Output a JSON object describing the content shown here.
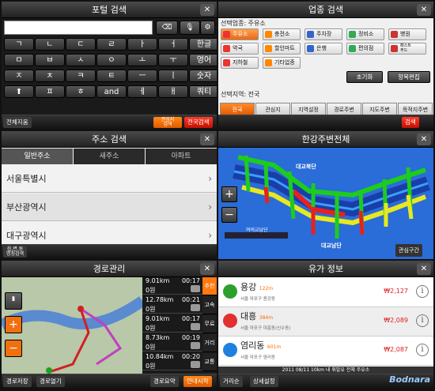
{
  "panel1": {
    "title": "포털 검색",
    "close": "✕",
    "del": "⌫",
    "mic": "🎙",
    "gear": "⚙",
    "keys": [
      [
        "ㄱ",
        "ㄴ",
        "ㄷ",
        "ㄹ",
        "ㅏ",
        "ㅓ"
      ],
      [
        "ㅁ",
        "ㅂ",
        "ㅅ",
        "ㅇ",
        "ㅗ",
        "ㅜ"
      ],
      [
        "ㅈ",
        "ㅊ",
        "ㅋ",
        "ㅌ",
        "ㅡ",
        "ㅣ"
      ],
      [
        "⬆",
        "ㅍ",
        "ㅎ",
        "and",
        "ㅔ",
        "ㅐ"
      ]
    ],
    "func_keys": [
      "한글",
      "영어",
      "숫자",
      "쿼티"
    ],
    "clear": "전체지움",
    "nearby": "관심지\n검색",
    "full": "전국검색"
  },
  "panel2": {
    "title": "업종 검색",
    "close": "✕",
    "selected_label": "선택업종: 주유소",
    "cats": [
      [
        "주유소",
        "충전소",
        "주차장",
        "정비소",
        "병원"
      ],
      [
        "약국",
        "할인마트",
        "은행",
        "편의점",
        "패스트\n푸드"
      ],
      [
        "지하철",
        "기타업종"
      ]
    ],
    "init": "초기화",
    "edit": "항목편집",
    "region_label": "선택지역: 전국",
    "tabs": [
      "전국",
      "관심지",
      "지역설정",
      "경로주변",
      "지도주변",
      "목적지주변"
    ],
    "search": "검색"
  },
  "panel3": {
    "title": "주소 검색",
    "close": "✕",
    "tabs": [
      "일반주소",
      "새주소",
      "아파트"
    ],
    "items": [
      "서울특별시",
      "부산광역시",
      "대구광역시"
    ],
    "bottom": "읍,면,동\n명칭검색"
  },
  "panel4": {
    "title": "한강주변전체",
    "close": "✕",
    "map_labels": [
      "성산",
      "양화",
      "서강",
      "원효",
      "한남",
      "동호",
      "성수",
      "영동",
      "청담",
      "잠실",
      "마포",
      "대교북단",
      "동작",
      "반포",
      "한남",
      "가양",
      "성수",
      "여의교",
      "여의교남단",
      "서울교남단",
      "대교남단",
      "구리"
    ],
    "legend": "",
    "interest": "관심구간"
  },
  "panel5": {
    "title": "경로관리",
    "close": "✕",
    "routes": [
      {
        "dist": "9.01km",
        "time": "00:17",
        "cost": "0원"
      },
      {
        "dist": "12.78km",
        "time": "00:21",
        "cost": "0원"
      },
      {
        "dist": "9.01km",
        "time": "00:17",
        "cost": "0원"
      },
      {
        "dist": "8.73km",
        "time": "00:19",
        "cost": "0원"
      },
      {
        "dist": "10.84km",
        "time": "00:20",
        "cost": "0원"
      }
    ],
    "side": [
      "추천",
      "고속",
      "무료",
      "거리",
      "교통"
    ],
    "save": "경로저장",
    "open": "경로열기",
    "summary": "경로요약",
    "guide": "안내시작"
  },
  "panel6": {
    "title": "유가 정보",
    "close": "✕",
    "stations": [
      {
        "name": "용강",
        "dist": "122m",
        "addr": "서울 마포구 용강동",
        "price": "₩2,127"
      },
      {
        "name": "대흥",
        "dist": "384m",
        "addr": "서울 마포구 대흥동(신수동)",
        "price": "₩2,089"
      },
      {
        "name": "염리동",
        "dist": "601m",
        "addr": "서울 마포구 염리동",
        "price": "₩2,087"
      }
    ],
    "footer": "2011 08/11 10km 내 휘발유 전체 주유소",
    "dist_order": "거리순",
    "detail": "상세설정"
  },
  "watermark": "Bodnara"
}
